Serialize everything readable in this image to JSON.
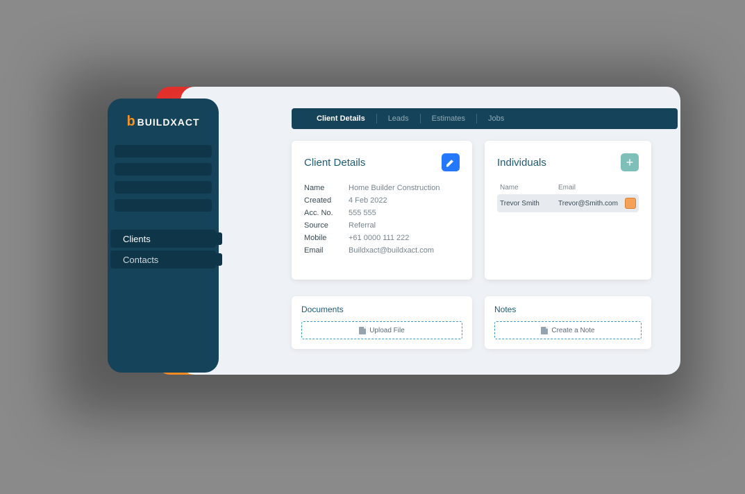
{
  "brand": {
    "mark": "b",
    "name": "BUILDXACT"
  },
  "sidebar": {
    "items": [
      {
        "label": "Clients",
        "active": true
      },
      {
        "label": "Contacts",
        "active": false
      }
    ]
  },
  "tabs": {
    "items": [
      {
        "label": "Client Details",
        "active": true
      },
      {
        "label": "Leads",
        "active": false
      },
      {
        "label": "Estimates",
        "active": false
      },
      {
        "label": "Jobs",
        "active": false
      }
    ]
  },
  "clientDetails": {
    "title": "Client Details",
    "fields": {
      "name": {
        "label": "Name",
        "value": "Home Builder Construction"
      },
      "created": {
        "label": "Created",
        "value": "4 Feb 2022"
      },
      "accNo": {
        "label": "Acc. No.",
        "value": "555 555"
      },
      "source": {
        "label": "Source",
        "value": "Referral"
      },
      "mobile": {
        "label": "Mobile",
        "value": "+61 0000 111 222"
      },
      "email": {
        "label": "Email",
        "value": "Buildxact@buildxact.com"
      }
    }
  },
  "individuals": {
    "title": "Individuals",
    "columns": {
      "name": "Name",
      "email": "Email"
    },
    "rows": [
      {
        "name": "Trevor Smith",
        "email": "Trevor@Smith.com"
      }
    ]
  },
  "documents": {
    "title": "Documents",
    "button": "Upload File"
  },
  "notes": {
    "title": "Notes",
    "button": "Create a Note"
  }
}
